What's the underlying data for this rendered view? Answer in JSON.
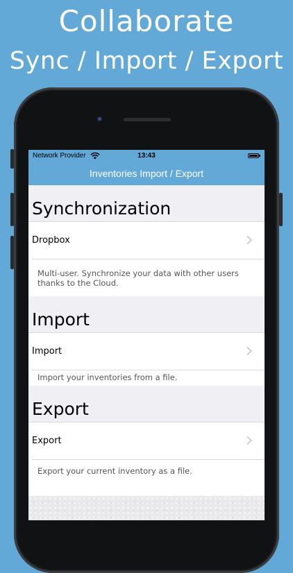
{
  "promo": {
    "title": "Collaborate",
    "subtitle": "Sync / Import / Export"
  },
  "status_bar": {
    "provider": "Network Provider",
    "time": "13:43"
  },
  "nav": {
    "title": "Inventories Import / Export"
  },
  "sections": {
    "sync": {
      "header": "Synchronization",
      "item_label": "Dropbox",
      "description": "Multi-user. Synchronize your data with other users thanks to the Cloud."
    },
    "import": {
      "header": "Import",
      "item_label": "Import",
      "description": "Import your inventories from a file."
    },
    "export": {
      "header": "Export",
      "item_label": "Export",
      "description": "Export your current inventory as a file."
    }
  },
  "colors": {
    "background": "#62a9d8",
    "nav_bar": "#62a9d8",
    "grouped_background": "#efeff4",
    "cell": "#ffffff",
    "chevron": "#c7c7cc"
  },
  "icons": [
    "wifi-icon",
    "battery-icon",
    "chevron-right-icon"
  ]
}
